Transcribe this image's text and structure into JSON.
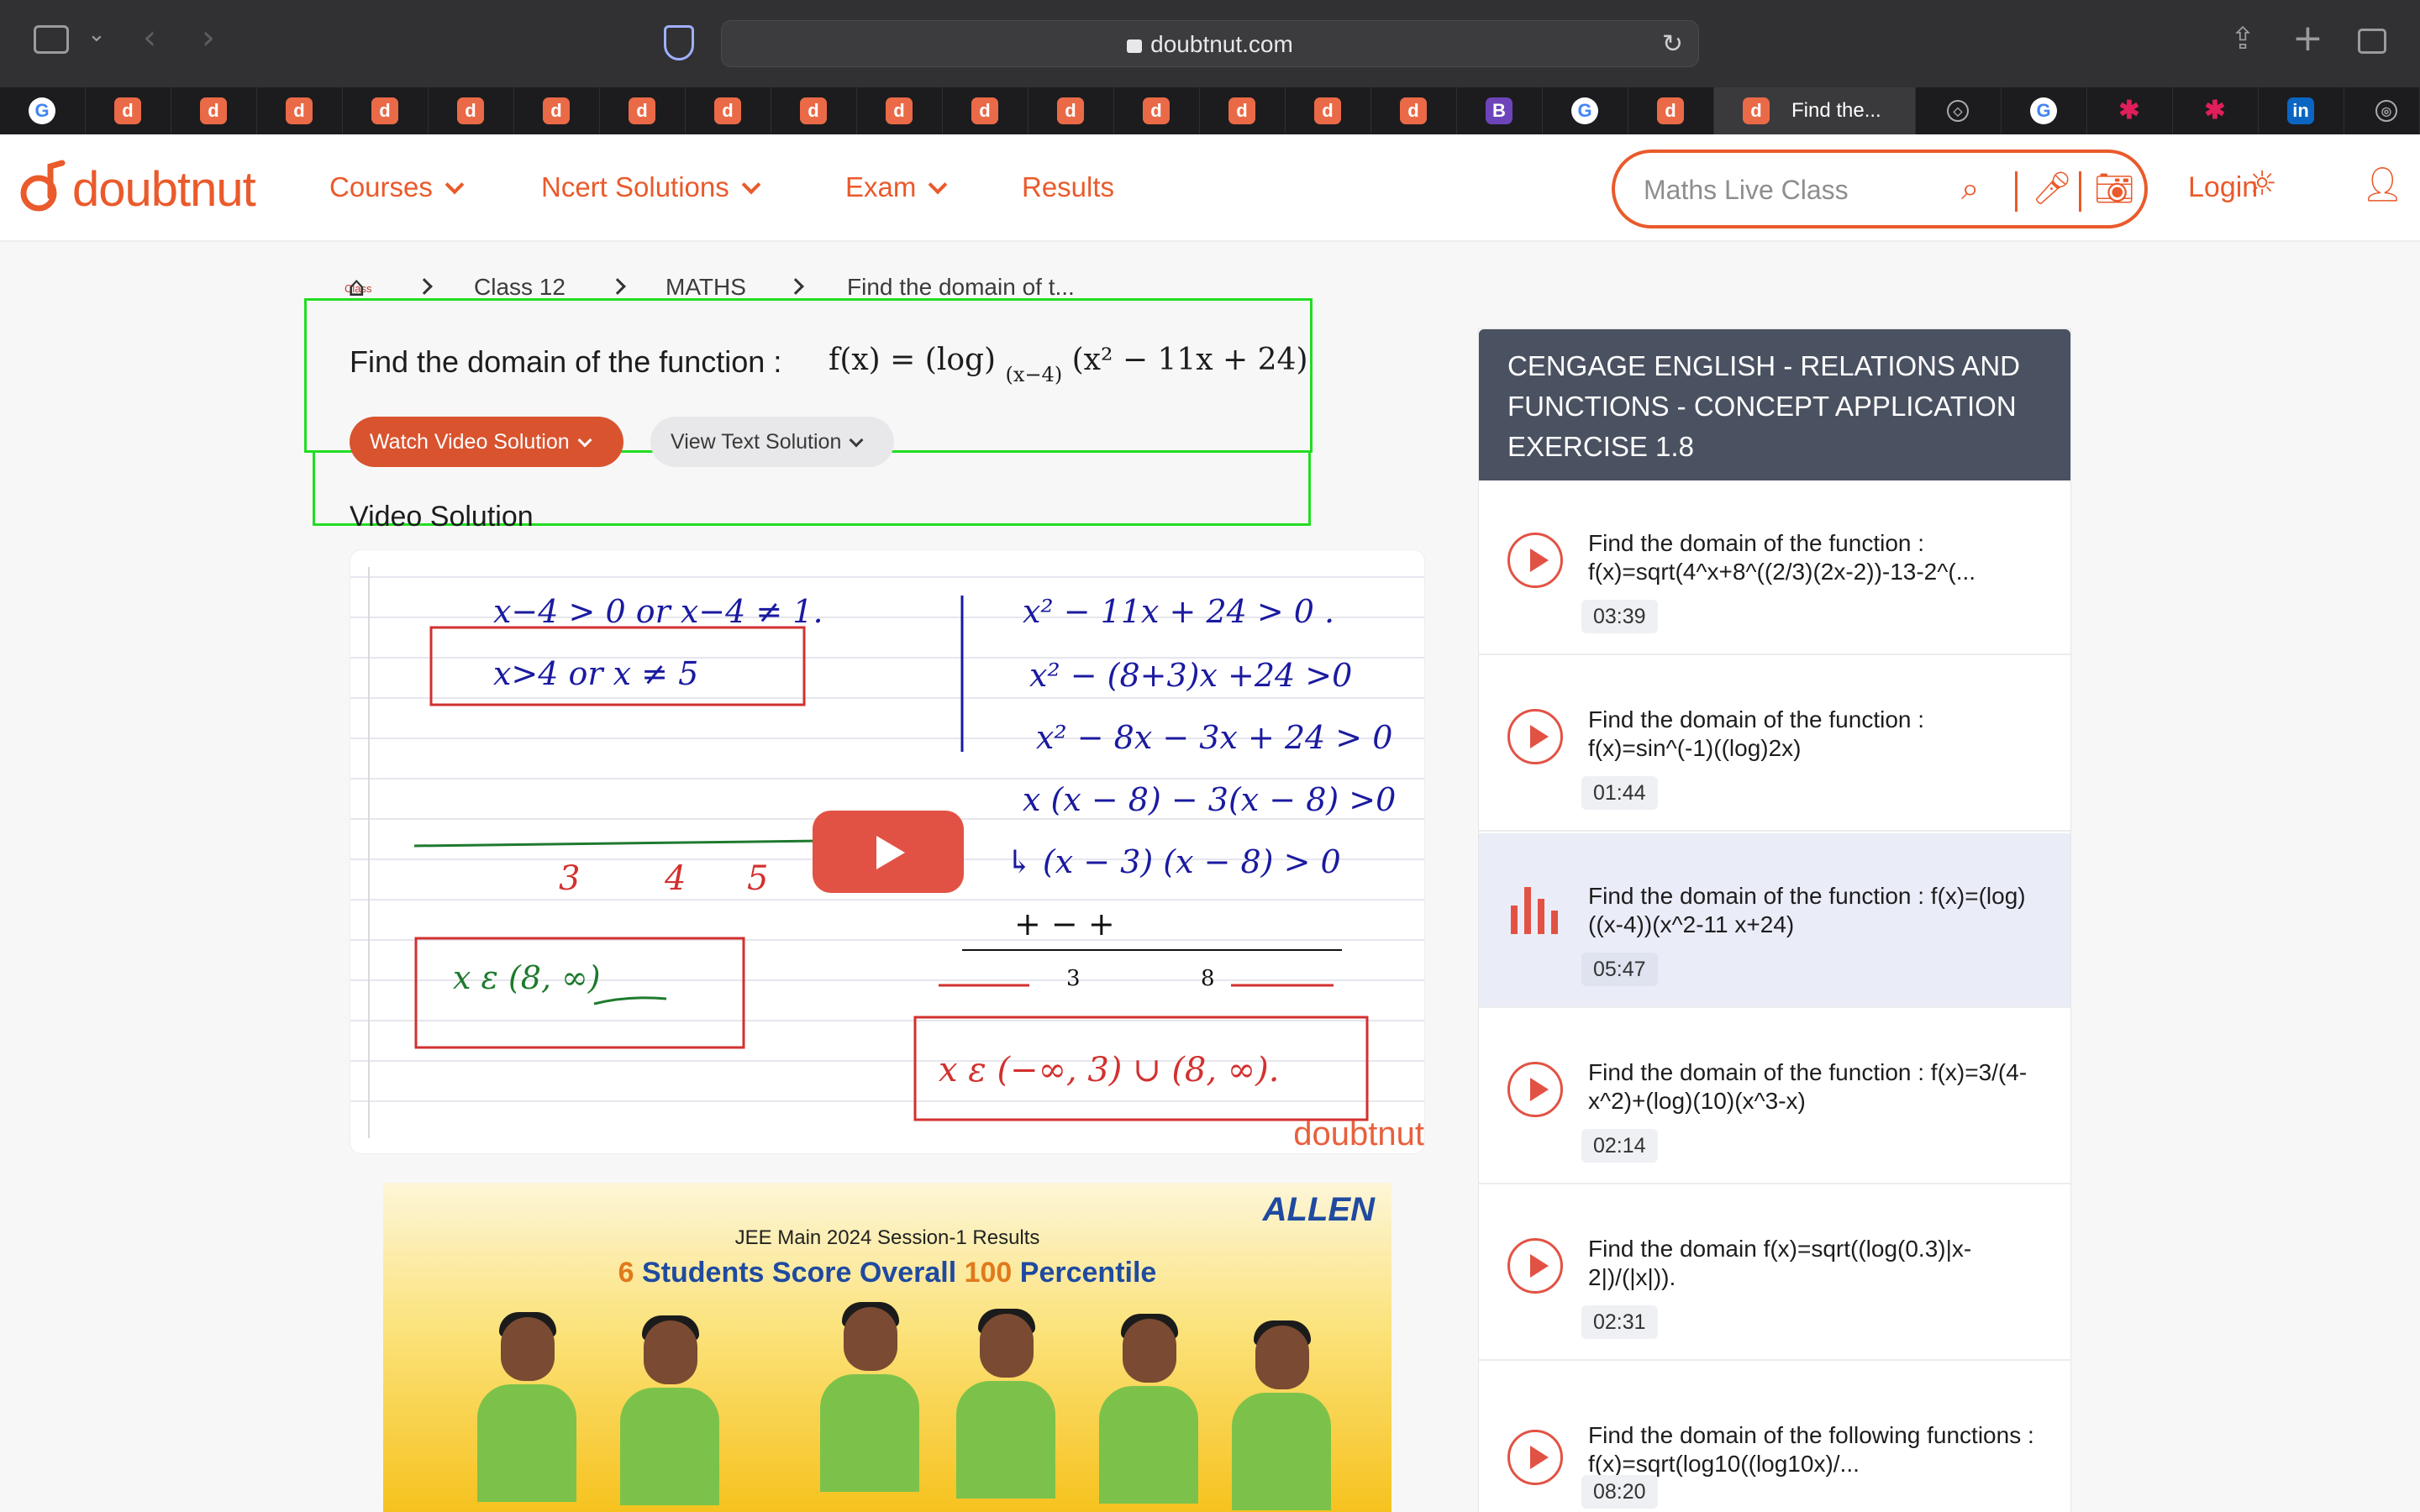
{
  "browser": {
    "url": "doubtnut.com",
    "active_tab_title": "Find the..."
  },
  "header": {
    "logo_text": "doubtnut",
    "nav": [
      "Courses",
      "Ncert Solutions",
      "Exam",
      "Results"
    ],
    "search_placeholder": "Maths Live Class",
    "login_label": "Login"
  },
  "breadcrumb": {
    "home_label": "Class",
    "items": [
      "Class 12",
      "MATHS",
      "Find the domain of t..."
    ]
  },
  "question": {
    "title": "Find the domain of the function :",
    "formula_prefix": "f(x) = (log)",
    "formula_sub": "(x−4)",
    "formula_suffix": "(x² − 11x + 24)",
    "watch_label": "Watch Video Solution",
    "text_label": "View Text Solution",
    "video_section_label": "Video Solution"
  },
  "video": {
    "watermark": "doubtnut"
  },
  "ad": {
    "brand": "ALLEN",
    "line1": "JEE Main 2024 Session-1 Results",
    "line2_num1": "6",
    "line2_mid": " Students Score Overall ",
    "line2_num2": "100",
    "line2_end": " Percentile"
  },
  "sidebar": {
    "heading": "CENGAGE ENGLISH - RELATIONS AND FUNCTIONS - CONCEPT APPLICATION EXERCISE 1.8",
    "items": [
      {
        "title": "Find the domain of the function : f(x)=sqrt(4^x+8^((2/3)(2x-2))-13-2^(...",
        "duration": "03:39"
      },
      {
        "title": "Find the domain of the function : f(x)=sin^(-1)((log)2x)",
        "duration": "01:44"
      },
      {
        "title": "Find the domain of the function : f(x)=(log)((x-4))(x^2-11 x+24)",
        "duration": "05:47"
      },
      {
        "title": "Find the domain of the function : f(x)=3/(4-x^2)+(log)(10)(x^3-x)",
        "duration": "02:14"
      },
      {
        "title": "Find the domain f(x)=sqrt((log(0.3)|x-2|)/(|x|)).",
        "duration": "02:31"
      },
      {
        "title": "Find the domain of the following functions : f(x)=sqrt(log10((log10x)/...",
        "duration": "08:20"
      }
    ]
  },
  "colors": {
    "accent": "#ea5a2b",
    "play_red": "#e25244",
    "sidebar_header": "#4a5161",
    "active_item_bg": "#eaedf7"
  }
}
